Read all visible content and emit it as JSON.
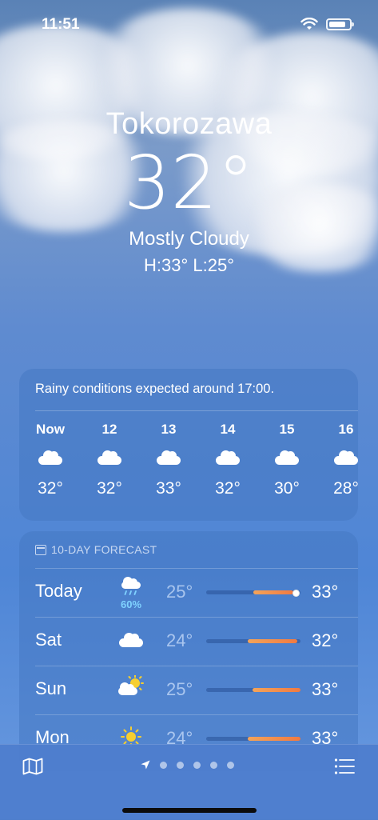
{
  "status_bar": {
    "time": "11:51"
  },
  "location": {
    "city": "Tokorozawa",
    "temperature": "32°",
    "condition": "Mostly Cloudy",
    "high_low": "H:33°  L:25°"
  },
  "hourly": {
    "note": "Rainy conditions expected around 17:00.",
    "hours": [
      {
        "label": "Now",
        "icon": "cloud-icon",
        "temp": "32°"
      },
      {
        "label": "12",
        "icon": "cloud-icon",
        "temp": "32°"
      },
      {
        "label": "13",
        "icon": "cloud-icon",
        "temp": "33°"
      },
      {
        "label": "14",
        "icon": "cloud-icon",
        "temp": "32°"
      },
      {
        "label": "15",
        "icon": "cloud-icon",
        "temp": "30°"
      },
      {
        "label": "16",
        "icon": "cloud-icon",
        "temp": "28°"
      }
    ]
  },
  "forecast": {
    "header": "10-DAY FORECAST",
    "days": [
      {
        "day": "Today",
        "icon": "cloud-rain-icon",
        "precip": "60%",
        "low": "25°",
        "high": "33°"
      },
      {
        "day": "Sat",
        "icon": "cloud-icon",
        "low": "24°",
        "high": "32°"
      },
      {
        "day": "Sun",
        "icon": "sun-behind-cloud-icon",
        "low": "25°",
        "high": "33°"
      },
      {
        "day": "Mon",
        "icon": "sun-icon",
        "low": "24°",
        "high": "33°"
      }
    ]
  },
  "bottom_bar": {
    "page_count": 5
  },
  "colors": {
    "range_bar_start": "#f3a45a",
    "range_bar_end": "#f07a42",
    "precip": "#7fd2ff"
  }
}
